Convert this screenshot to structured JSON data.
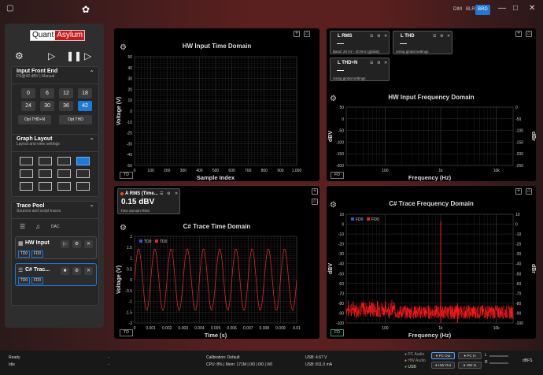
{
  "topbar": {
    "buttons": [
      "DIM",
      "BLR",
      "BRD"
    ],
    "active": "BRD"
  },
  "logo": {
    "a": "Quant",
    "b": "Asylum"
  },
  "sidebar": {
    "input": {
      "title": "Input Front End",
      "subtitle": "FS@42 dBV | Manual",
      "ranges": [
        "0",
        "6",
        "12",
        "18",
        "24",
        "30",
        "36",
        "42"
      ],
      "selected": "42",
      "opt1": "Opt THD+N",
      "opt2": "Opt THD"
    },
    "graph": {
      "title": "Graph Layout",
      "subtitle": "Layout and view settings"
    },
    "pool": {
      "title": "Trace Pool",
      "subtitle": "Sources and script traces",
      "dac": "DAC",
      "traces": [
        {
          "name": "HW Input",
          "tags": [
            "TD0",
            "FD0"
          ]
        },
        {
          "name": "C# Trac...",
          "tags": [
            "TD0",
            "FD0"
          ]
        }
      ]
    }
  },
  "panels": {
    "hw_time": {
      "title": "HW Input Time Domain",
      "ylabel": "Voltage (V)",
      "xlabel": "Sample Index",
      "badge": "TD"
    },
    "hw_freq": {
      "title": "HW Input Frequency Domain",
      "ylabel": "dBV",
      "ylabel_r": "dBr",
      "xlabel": "Frequency (Hz)",
      "badge": "FD"
    },
    "cs_time": {
      "title": "C# Trace Time Domain",
      "ylabel": "Voltage (V)",
      "xlabel": "Time (s)",
      "badge": "TD"
    },
    "cs_freq": {
      "title": "C# Trace Frequency Domain",
      "ylabel": "dBV",
      "ylabel_r": "dBr",
      "xlabel": "Frequency (Hz)",
      "badge": "FD"
    }
  },
  "readouts": {
    "rms": {
      "title": "L RMS",
      "value": "—",
      "note": "Band: 20 Hz - 20 kHz (global)"
    },
    "thd": {
      "title": "L THD",
      "value": "—",
      "note": "Using global settings"
    },
    "thdn": {
      "title": "L THD+N",
      "value": "—",
      "note": "Using global settings"
    },
    "arms": {
      "title": "A RMS (Time...",
      "value": "0.15 dBV",
      "note": "Time domain RMS"
    }
  },
  "status": {
    "l1": "Ready",
    "l2": "Idle",
    "dash1": "-",
    "dash2": "-",
    "calib": "Calibration: Default",
    "cpu": "CPU: 8% | Mem: 171M | 0/0 | 0/0 | 0/0",
    "usbv": "USB: 4.67 V",
    "usba": "USB: 811.0 mA",
    "leds": [
      "PC Audio",
      "HW Audio",
      "USB"
    ],
    "btns": [
      "PC Out",
      "PC In",
      "HW Out",
      "HW In"
    ],
    "meter": "dBFS",
    "L": "L",
    "R": "R"
  },
  "chart_data": [
    {
      "type": "line",
      "title": "HW Input Time Domain",
      "xlabel": "Sample Index",
      "ylabel": "Voltage (V)",
      "xlim": [
        0,
        1000
      ],
      "ylim": [
        -50,
        50
      ],
      "x_ticks": [
        "0",
        "100",
        "200",
        "300",
        "400",
        "500",
        "600",
        "700",
        "800",
        "900",
        "1,000"
      ],
      "y_ticks": [
        "50",
        "40",
        "30",
        "20",
        "10",
        "0",
        "-10",
        "-20",
        "-30",
        "-40",
        "-50"
      ],
      "series": []
    },
    {
      "type": "line",
      "title": "HW Input Frequency Domain",
      "xlabel": "Frequency (Hz)",
      "ylabel": "dBV",
      "xscale": "log",
      "xlim": [
        20,
        20000
      ],
      "ylim": [
        -200,
        50
      ],
      "x_ticks": [
        "100",
        "1k",
        "10k"
      ],
      "y_ticks": [
        "50",
        "0",
        "-50",
        "-100",
        "-150",
        "-200"
      ],
      "y2_ticks": [
        "0",
        "-50",
        "-100",
        "-150",
        "-200",
        "-250"
      ],
      "series": []
    },
    {
      "type": "line",
      "title": "C# Trace Time Domain",
      "xlabel": "Time (s)",
      "ylabel": "Voltage (V)",
      "xlim": [
        0,
        0.01
      ],
      "ylim": [
        -2,
        2
      ],
      "x_ticks": [
        "0",
        "0.001",
        "0.002",
        "0.003",
        "0.004",
        "0.005",
        "0.006",
        "0.007",
        "0.008",
        "0.009",
        "0.01"
      ],
      "y_ticks": [
        "2",
        "1.5",
        "1",
        "0.5",
        "0",
        "-0.5",
        "-1",
        "-1.5",
        "-2"
      ],
      "legend": [
        "TD0",
        "TD0"
      ],
      "series": [
        {
          "name": "TD0",
          "frequency_hz": 1000,
          "amplitude": 1.41,
          "color": "#d9262e"
        }
      ]
    },
    {
      "type": "line",
      "title": "C# Trace Frequency Domain",
      "xlabel": "Frequency (Hz)",
      "ylabel": "dBV",
      "xscale": "log",
      "xlim": [
        20,
        20000
      ],
      "ylim": [
        -100,
        10
      ],
      "x_ticks": [
        "100",
        "1k",
        "10k"
      ],
      "y_ticks": [
        "10",
        "0",
        "-10",
        "-20",
        "-30",
        "-40",
        "-50",
        "-60",
        "-70",
        "-80",
        "-90",
        "-100"
      ],
      "y2_ticks": [
        "10",
        "0",
        "-10",
        "-20",
        "-30",
        "-40",
        "-50",
        "-60",
        "-70",
        "-80",
        "-90",
        "-100"
      ],
      "legend": [
        "FD0",
        "FD0"
      ],
      "series": [
        {
          "name": "FD0",
          "color": "#ff1a1a",
          "peaks": [
            {
              "x": 1000,
              "y": 3
            },
            {
              "x": 2000,
              "y": -80
            }
          ],
          "noise_floor": -90
        }
      ]
    }
  ]
}
